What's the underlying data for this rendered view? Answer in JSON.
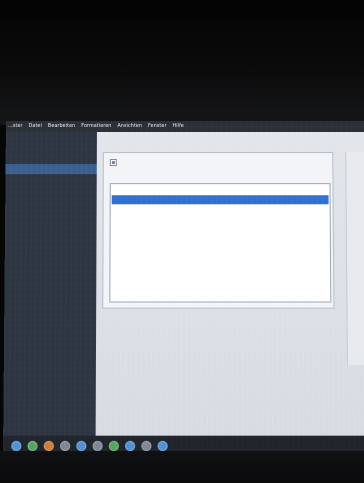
{
  "menu": {
    "items": [
      "…ster",
      "Datei",
      "Bearbeiten",
      "Formatieren",
      "Ansichten",
      "Fenster",
      "Hilfe"
    ]
  },
  "ui": {
    "accent_color": "#2f6fd0",
    "sidebar_color": "#2e3542",
    "dialog_bg": "#f2f4f7"
  }
}
